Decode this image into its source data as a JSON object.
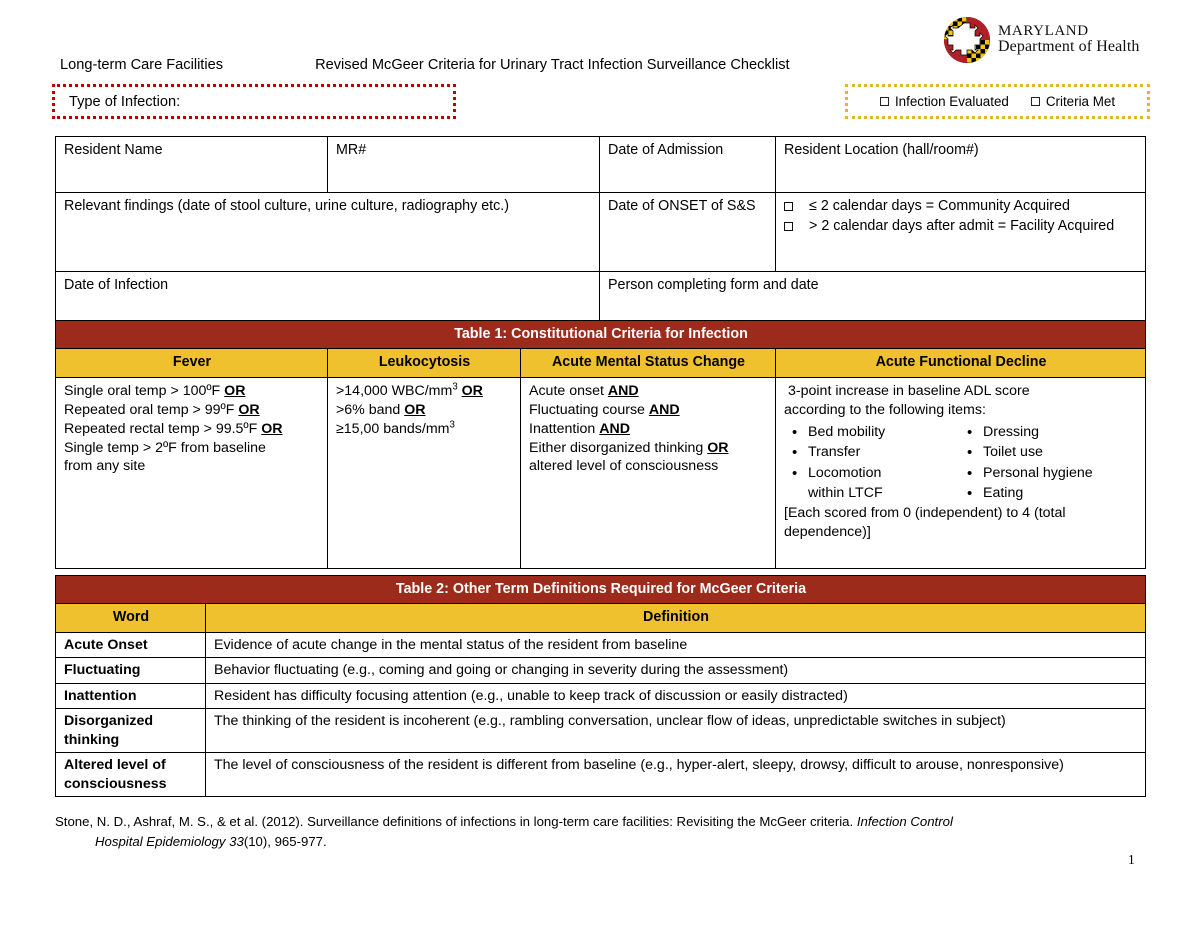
{
  "header": {
    "logo_line1": "MARYLAND",
    "logo_line2": "Department of Health",
    "left_label": "Long-term Care Facilities",
    "title": "Revised McGeer Criteria for Urinary Tract Infection Surveillance Checklist",
    "type_of_infection_label": "Type of Infection:",
    "infection_evaluated_label": "Infection Evaluated",
    "criteria_met_label": "Criteria Met"
  },
  "info_table": {
    "resident_name": "Resident Name",
    "mr_number": "MR#",
    "date_of_admission": "Date of Admission",
    "resident_location": "Resident Location (hall/room#)",
    "relevant_findings": "Relevant findings (date of stool culture, urine culture, radiography etc.)",
    "date_of_onset": "Date of ONSET of S&S",
    "onset_options": [
      "≤ 2 calendar days = Community Acquired",
      "> 2 calendar days after admit = Facility Acquired"
    ],
    "date_of_infection": "Date of Infection",
    "person_completing": "Person completing form and date"
  },
  "table1": {
    "title": "Table 1: Constitutional Criteria for Infection",
    "columns": [
      "Fever",
      "Leukocytosis",
      "Acute Mental Status Change",
      "Acute Functional Decline"
    ],
    "fever": {
      "lines": [
        {
          "text": "Single oral temp > 100ºF ",
          "bold_tail": "OR"
        },
        {
          "text": "Repeated oral temp > 99ºF ",
          "bold_tail": "OR"
        },
        {
          "text": "Repeated rectal temp > 99.5ºF ",
          "bold_tail": "OR"
        },
        {
          "text": "Single temp > 2ºF from baseline",
          "bold_tail": ""
        },
        {
          "text": "from any site",
          "bold_tail": ""
        }
      ]
    },
    "leukocytosis": {
      "line1_pre": ">14,000 WBC/mm",
      "line1_sup": "3",
      "line1_tail": "OR",
      "line2_pre": ">6% band ",
      "line2_tail": "OR",
      "line3_pre": "≥15,00 bands/mm",
      "line3_sup": "3"
    },
    "mental_status": {
      "lines": [
        {
          "text": "Acute onset ",
          "bold_tail": "AND"
        },
        {
          "text": "Fluctuating course ",
          "bold_tail": "AND"
        },
        {
          "text": "Inattention ",
          "bold_tail": "AND"
        },
        {
          "text": "Either disorganized thinking ",
          "bold_tail": "OR"
        },
        {
          "text": "altered level of consciousness",
          "bold_tail": ""
        }
      ]
    },
    "functional_decline": {
      "intro_line1": "3-point increase in baseline ADL score",
      "intro_line2": "according to the following items:",
      "items_left": [
        "Bed mobility",
        "Transfer",
        "Locomotion",
        "within LTCF"
      ],
      "items_right": [
        "Dressing",
        "Toilet use",
        "Personal hygiene",
        "Eating"
      ],
      "footnote_line1": "[Each scored from 0 (independent) to 4 (total",
      "footnote_line2": "dependence)]"
    }
  },
  "table2": {
    "title": "Table 2: Other Term Definitions Required for McGeer Criteria",
    "columns": [
      "Word",
      "Definition"
    ],
    "rows": [
      {
        "word": "Acute Onset",
        "definition": "Evidence of acute change in the mental status of the resident from baseline"
      },
      {
        "word": "Fluctuating",
        "definition": "Behavior fluctuating (e.g., coming and going or changing in severity during the assessment)"
      },
      {
        "word": "Inattention",
        "definition": "Resident has difficulty focusing attention (e.g., unable to keep track of discussion or easily distracted)"
      },
      {
        "word": "Disorganized thinking",
        "definition": "The thinking of the resident is incoherent (e.g., rambling conversation, unclear flow of ideas, unpredictable switches in subject)"
      },
      {
        "word": "Altered level of consciousness",
        "definition": "The level of consciousness of the resident is different from baseline (e.g., hyper-alert, sleepy, drowsy, difficult to arouse, nonresponsive)"
      }
    ]
  },
  "footer": {
    "citation_part1": "Stone, N. D., Ashraf, M. S., & et al.  (2012). Surveillance definitions of infections in long-term care facilities: Revisiting the McGeer criteria. ",
    "citation_italic1": "Infection Control",
    "citation_italic2": "Hospital Epidemiology 33",
    "citation_part2": "(10), 965-977.",
    "page_number": "1"
  },
  "colors": {
    "table_title_bg": "#9C2B1C",
    "table_subhead_bg": "#EFC12E",
    "type_box_border": "#C00000",
    "eval_box_border": "#E8B229",
    "logo_red": "#B12029",
    "logo_gold": "#F2C318"
  }
}
